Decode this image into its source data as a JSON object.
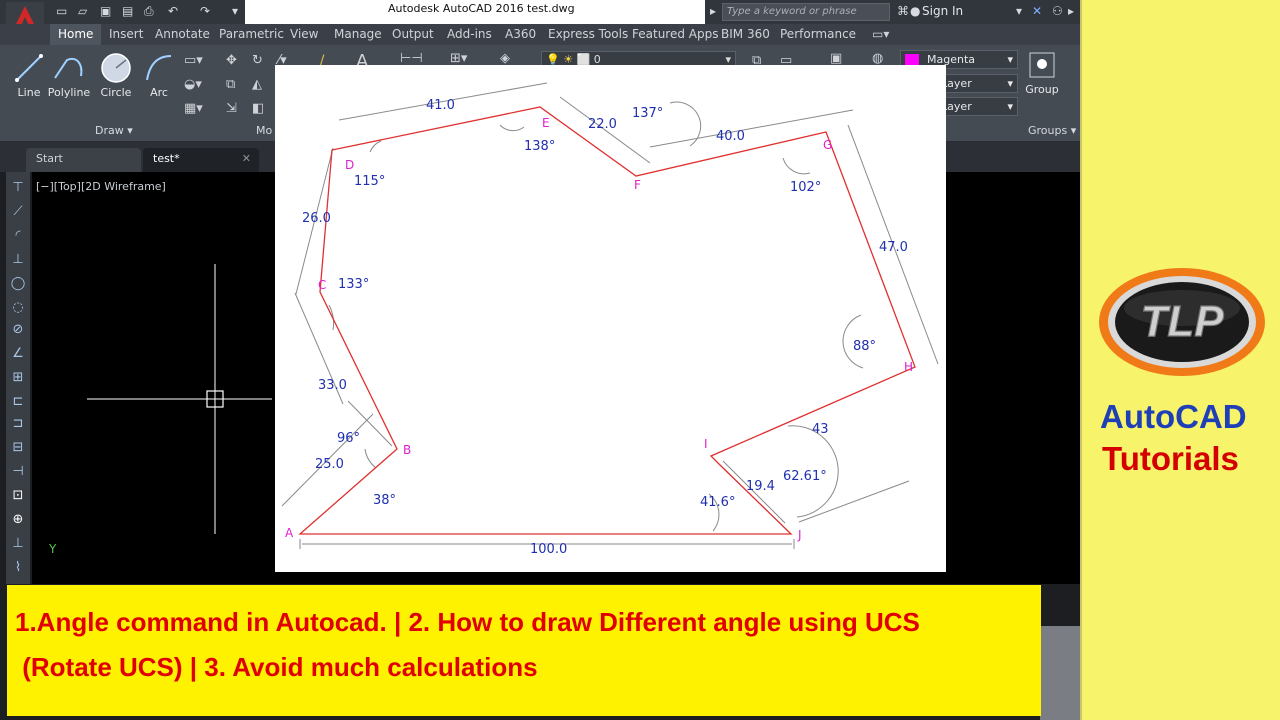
{
  "title_bar": {
    "app_title": "Autodesk AutoCAD 2016",
    "file_name": "test.dwg",
    "search_placeholder": "Type a keyword or phrase",
    "sign_in": "Sign In"
  },
  "ribbon": {
    "tabs": [
      {
        "label": "Home"
      },
      {
        "label": "Insert"
      },
      {
        "label": "Annotate"
      },
      {
        "label": "Parametric"
      },
      {
        "label": "View"
      },
      {
        "label": "Manage"
      },
      {
        "label": "Output"
      },
      {
        "label": "Add-ins"
      },
      {
        "label": "A360"
      },
      {
        "label": "Express Tools"
      },
      {
        "label": "Featured Apps"
      },
      {
        "label": "BIM 360"
      },
      {
        "label": "Performance"
      }
    ],
    "draw_tools": [
      {
        "label": "Line",
        "icon": "line-icon"
      },
      {
        "label": "Polyline",
        "icon": "polyline-icon"
      },
      {
        "label": "Circle",
        "icon": "circle-icon"
      },
      {
        "label": "Arc",
        "icon": "arc-icon"
      }
    ],
    "draw_panel_label": "Draw",
    "modify_panel_label_partial": "Mo",
    "layer_value": "0",
    "properties": {
      "color": "Magenta",
      "linetype": "ByLayer",
      "lineweight": "ByLayer",
      "color_hex": "#ff00ff"
    },
    "group_label": "Group",
    "groups_panel_label": "Groups"
  },
  "file_tabs": [
    {
      "label": "Start"
    },
    {
      "label": "test*"
    }
  ],
  "viewport_label": "[−][Top][2D Wireframe]",
  "ucs_y_label": "Y",
  "drawing": {
    "vertices": [
      {
        "label": "A"
      },
      {
        "label": "B"
      },
      {
        "label": "C"
      },
      {
        "label": "D"
      },
      {
        "label": "E"
      },
      {
        "label": "F"
      },
      {
        "label": "G"
      },
      {
        "label": "H"
      },
      {
        "label": "I"
      },
      {
        "label": "J"
      }
    ],
    "lengths": {
      "ab": "25.0",
      "bc": "33.0",
      "cd": "26.0",
      "de": "41.0",
      "ef": "22.0",
      "fg": "40.0",
      "gh": "47.0",
      "hi": "43",
      "ij": "19.4",
      "aj": "100.0"
    },
    "angles": {
      "a": "38°",
      "b": "96°",
      "c": "133°",
      "d": "115°",
      "e": "138°",
      "f": "137°",
      "g": "102°",
      "h": "88°",
      "i": "62.61°",
      "j": "41.6°"
    }
  },
  "banner": {
    "line1": "1.Angle command in Autocad. | 2. How to draw Different angle using UCS",
    "line2": " (Rotate UCS) | 3. Avoid much calculations"
  },
  "branding": {
    "logo_text": "TLP",
    "title_1": "AutoCAD",
    "title_2": "Tutorials"
  }
}
